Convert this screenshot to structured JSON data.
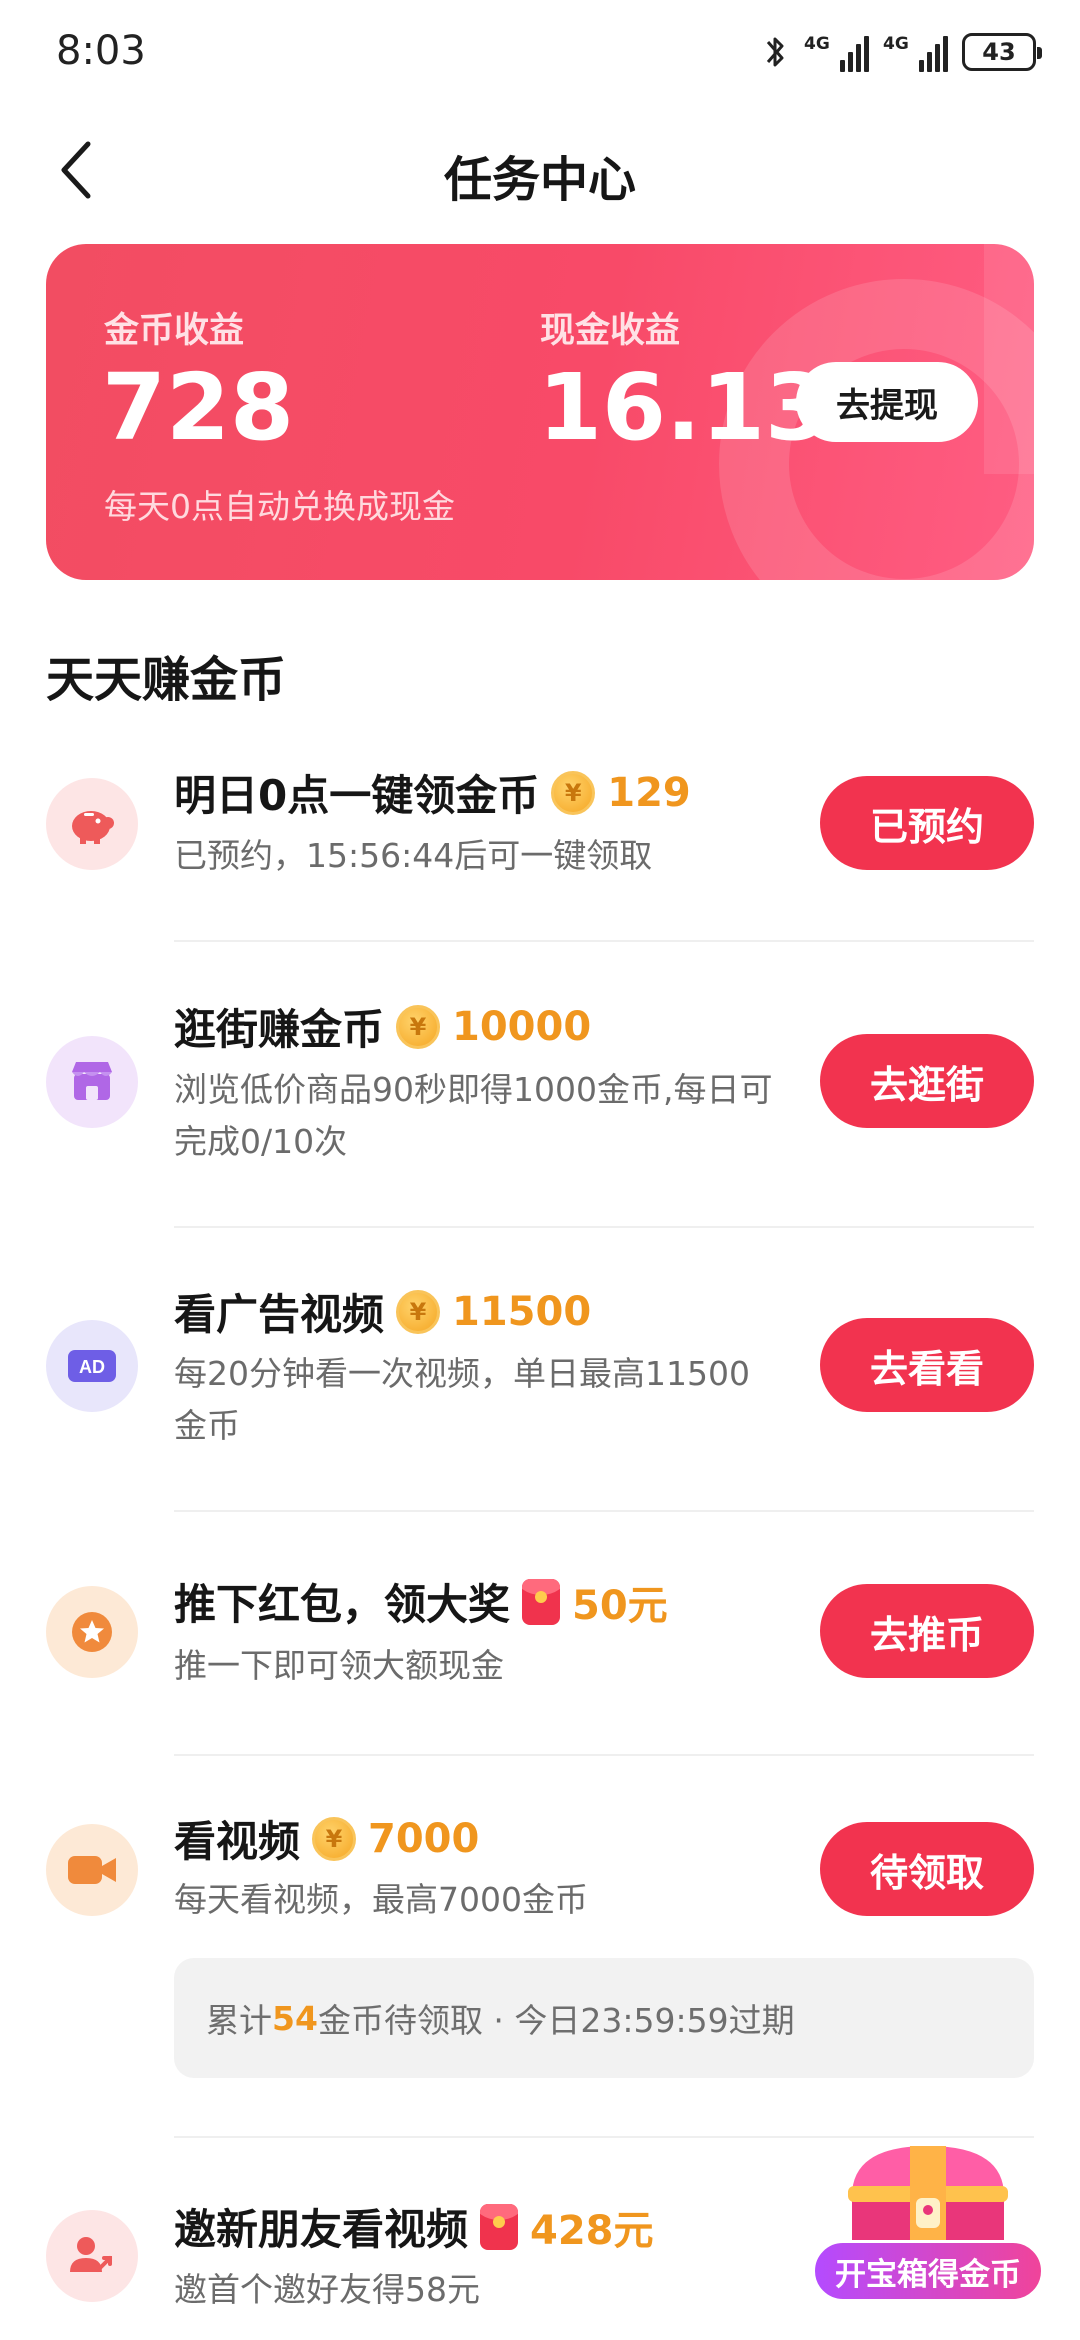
{
  "status_bar": {
    "time": "8:03",
    "network_1": "4G",
    "network_2": "4G",
    "battery": "43"
  },
  "nav": {
    "title": "任务中心"
  },
  "earnings": {
    "coin_label": "金币收益",
    "coin_value": "728",
    "coin_note": "每天0点自动兑换成现金",
    "cash_label": "现金收益",
    "cash_value": "16.13",
    "withdraw_button": "去提现"
  },
  "section_title": "天天赚金币",
  "tasks": [
    {
      "title": "明日0点一键领金币",
      "reward_type": "coin",
      "reward": "129",
      "desc": "已预约，15:56:44后可一键领取",
      "button": "已预约",
      "icon": "piggy-bank-icon",
      "icon_bg": "#fde5e5",
      "icon_color": "#ee5a5a"
    },
    {
      "title": "逛街赚金币",
      "reward_type": "coin",
      "reward": "10000",
      "desc": "浏览低价商品90秒即得1000金币,每日可完成0/10次",
      "button": "去逛街",
      "icon": "shop-icon",
      "icon_bg": "#f2e4fb",
      "icon_color": "#b067e6"
    },
    {
      "title": "看广告视频",
      "reward_type": "coin",
      "reward": "11500",
      "desc": "每20分钟看一次视频，单日最高11500金币",
      "button": "去看看",
      "icon": "ad-icon",
      "icon_bg": "#e8e6fb",
      "icon_color": "#6e5ee6"
    },
    {
      "title": "推下红包，领大奖",
      "reward_type": "cash",
      "reward": "50元",
      "desc": "推一下即可领大额现金",
      "button": "去推币",
      "icon": "star-medal-icon",
      "icon_bg": "#fde9d6",
      "icon_color": "#f08a3c"
    },
    {
      "title": "看视频",
      "reward_type": "coin",
      "reward": "7000",
      "desc": "每天看视频，最高7000金币",
      "button": "待领取",
      "icon": "video-camera-icon",
      "icon_bg": "#fde9d6",
      "icon_color": "#f08a3c"
    },
    {
      "title": "邀新朋友看视频",
      "reward_type": "cash",
      "reward": "428元",
      "desc": "邀首个邀好友得58元",
      "button": "",
      "icon": "invite-friends-icon",
      "icon_bg": "#fde5e5",
      "icon_color": "#ee5a5a"
    }
  ],
  "pending": {
    "prefix": "累计",
    "amount": "54",
    "suffix": "金币待领取 · 今日23:59:59过期"
  },
  "treasure": {
    "label": "开宝箱得金币"
  },
  "colors": {
    "accent": "#f2334f",
    "reward": "#f0961e",
    "card_start": "#f24d62",
    "card_end": "#ff5d83"
  }
}
